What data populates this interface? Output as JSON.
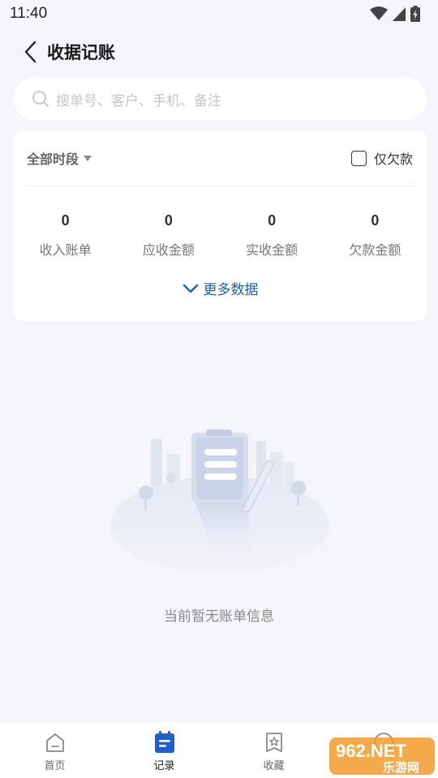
{
  "status_bar": {
    "time": "11:40"
  },
  "header": {
    "title": "收据记账"
  },
  "search": {
    "placeholder": "搜单号、客户、手机、备注"
  },
  "summary": {
    "period_label": "全部时段",
    "owe_only_label": "仅欠款",
    "owe_only_checked": false,
    "stats": [
      {
        "value": "0",
        "label": "收入账单"
      },
      {
        "value": "0",
        "label": "应收金额"
      },
      {
        "value": "0",
        "label": "实收金额"
      },
      {
        "value": "0",
        "label": "欠款金额"
      }
    ],
    "more_label": "更多数据"
  },
  "empty_state": {
    "message": "当前暂无账单信息"
  },
  "tabbar": {
    "active_index": 1,
    "items": [
      {
        "label": "首页",
        "icon": "home-icon"
      },
      {
        "label": "记录",
        "icon": "record-icon"
      },
      {
        "label": "收藏",
        "icon": "favorite-icon"
      },
      {
        "label": "",
        "icon": "profile-icon"
      }
    ]
  },
  "watermark": {
    "brand": "962.NET",
    "site": "乐游网"
  },
  "colors": {
    "accent": "#1f5fae",
    "background": "#f3f5fa",
    "tab_active": "#1e5fc9"
  }
}
